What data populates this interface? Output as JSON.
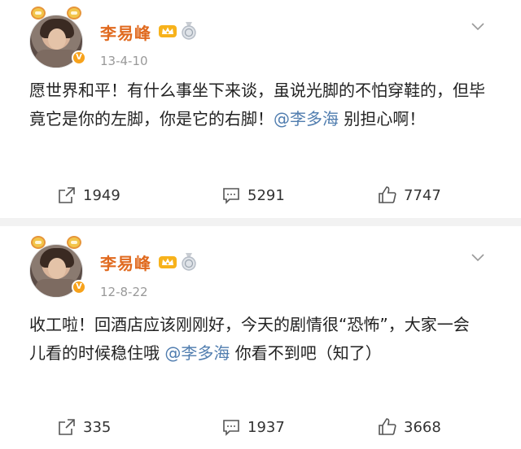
{
  "posts": [
    {
      "username": "李易峰",
      "date": "13-4-10",
      "content_parts": [
        "愿世界和平！有什么事坐下来谈，虽说光脚的不怕穿鞋的，但毕竟它是你的左脚，你是它的右脚！",
        "@李多海",
        " 别担心啊！"
      ],
      "shares": "1949",
      "comments": "5291",
      "likes": "7747"
    },
    {
      "username": "李易峰",
      "date": "12-8-22",
      "content_parts": [
        "收工啦！回酒店应该刚刚好，今天的剧情很“恐怖”，大家一会儿看的时候稳住哦 ",
        "@李多海",
        " 你看不到吧（知了）"
      ],
      "shares": "335",
      "comments": "1937",
      "likes": "3668"
    }
  ],
  "colors": {
    "username": "#e06a1f",
    "mention": "#507daf",
    "meta": "#999999",
    "separator": "#f2f2f2"
  },
  "icons": {
    "share": "share-icon",
    "comment": "comment-icon",
    "like": "thumbs-up-icon",
    "more": "chevron-down-icon",
    "vip": "vip-crown-icon",
    "medal": "medal-icon",
    "verified": "verified-badge-icon"
  }
}
